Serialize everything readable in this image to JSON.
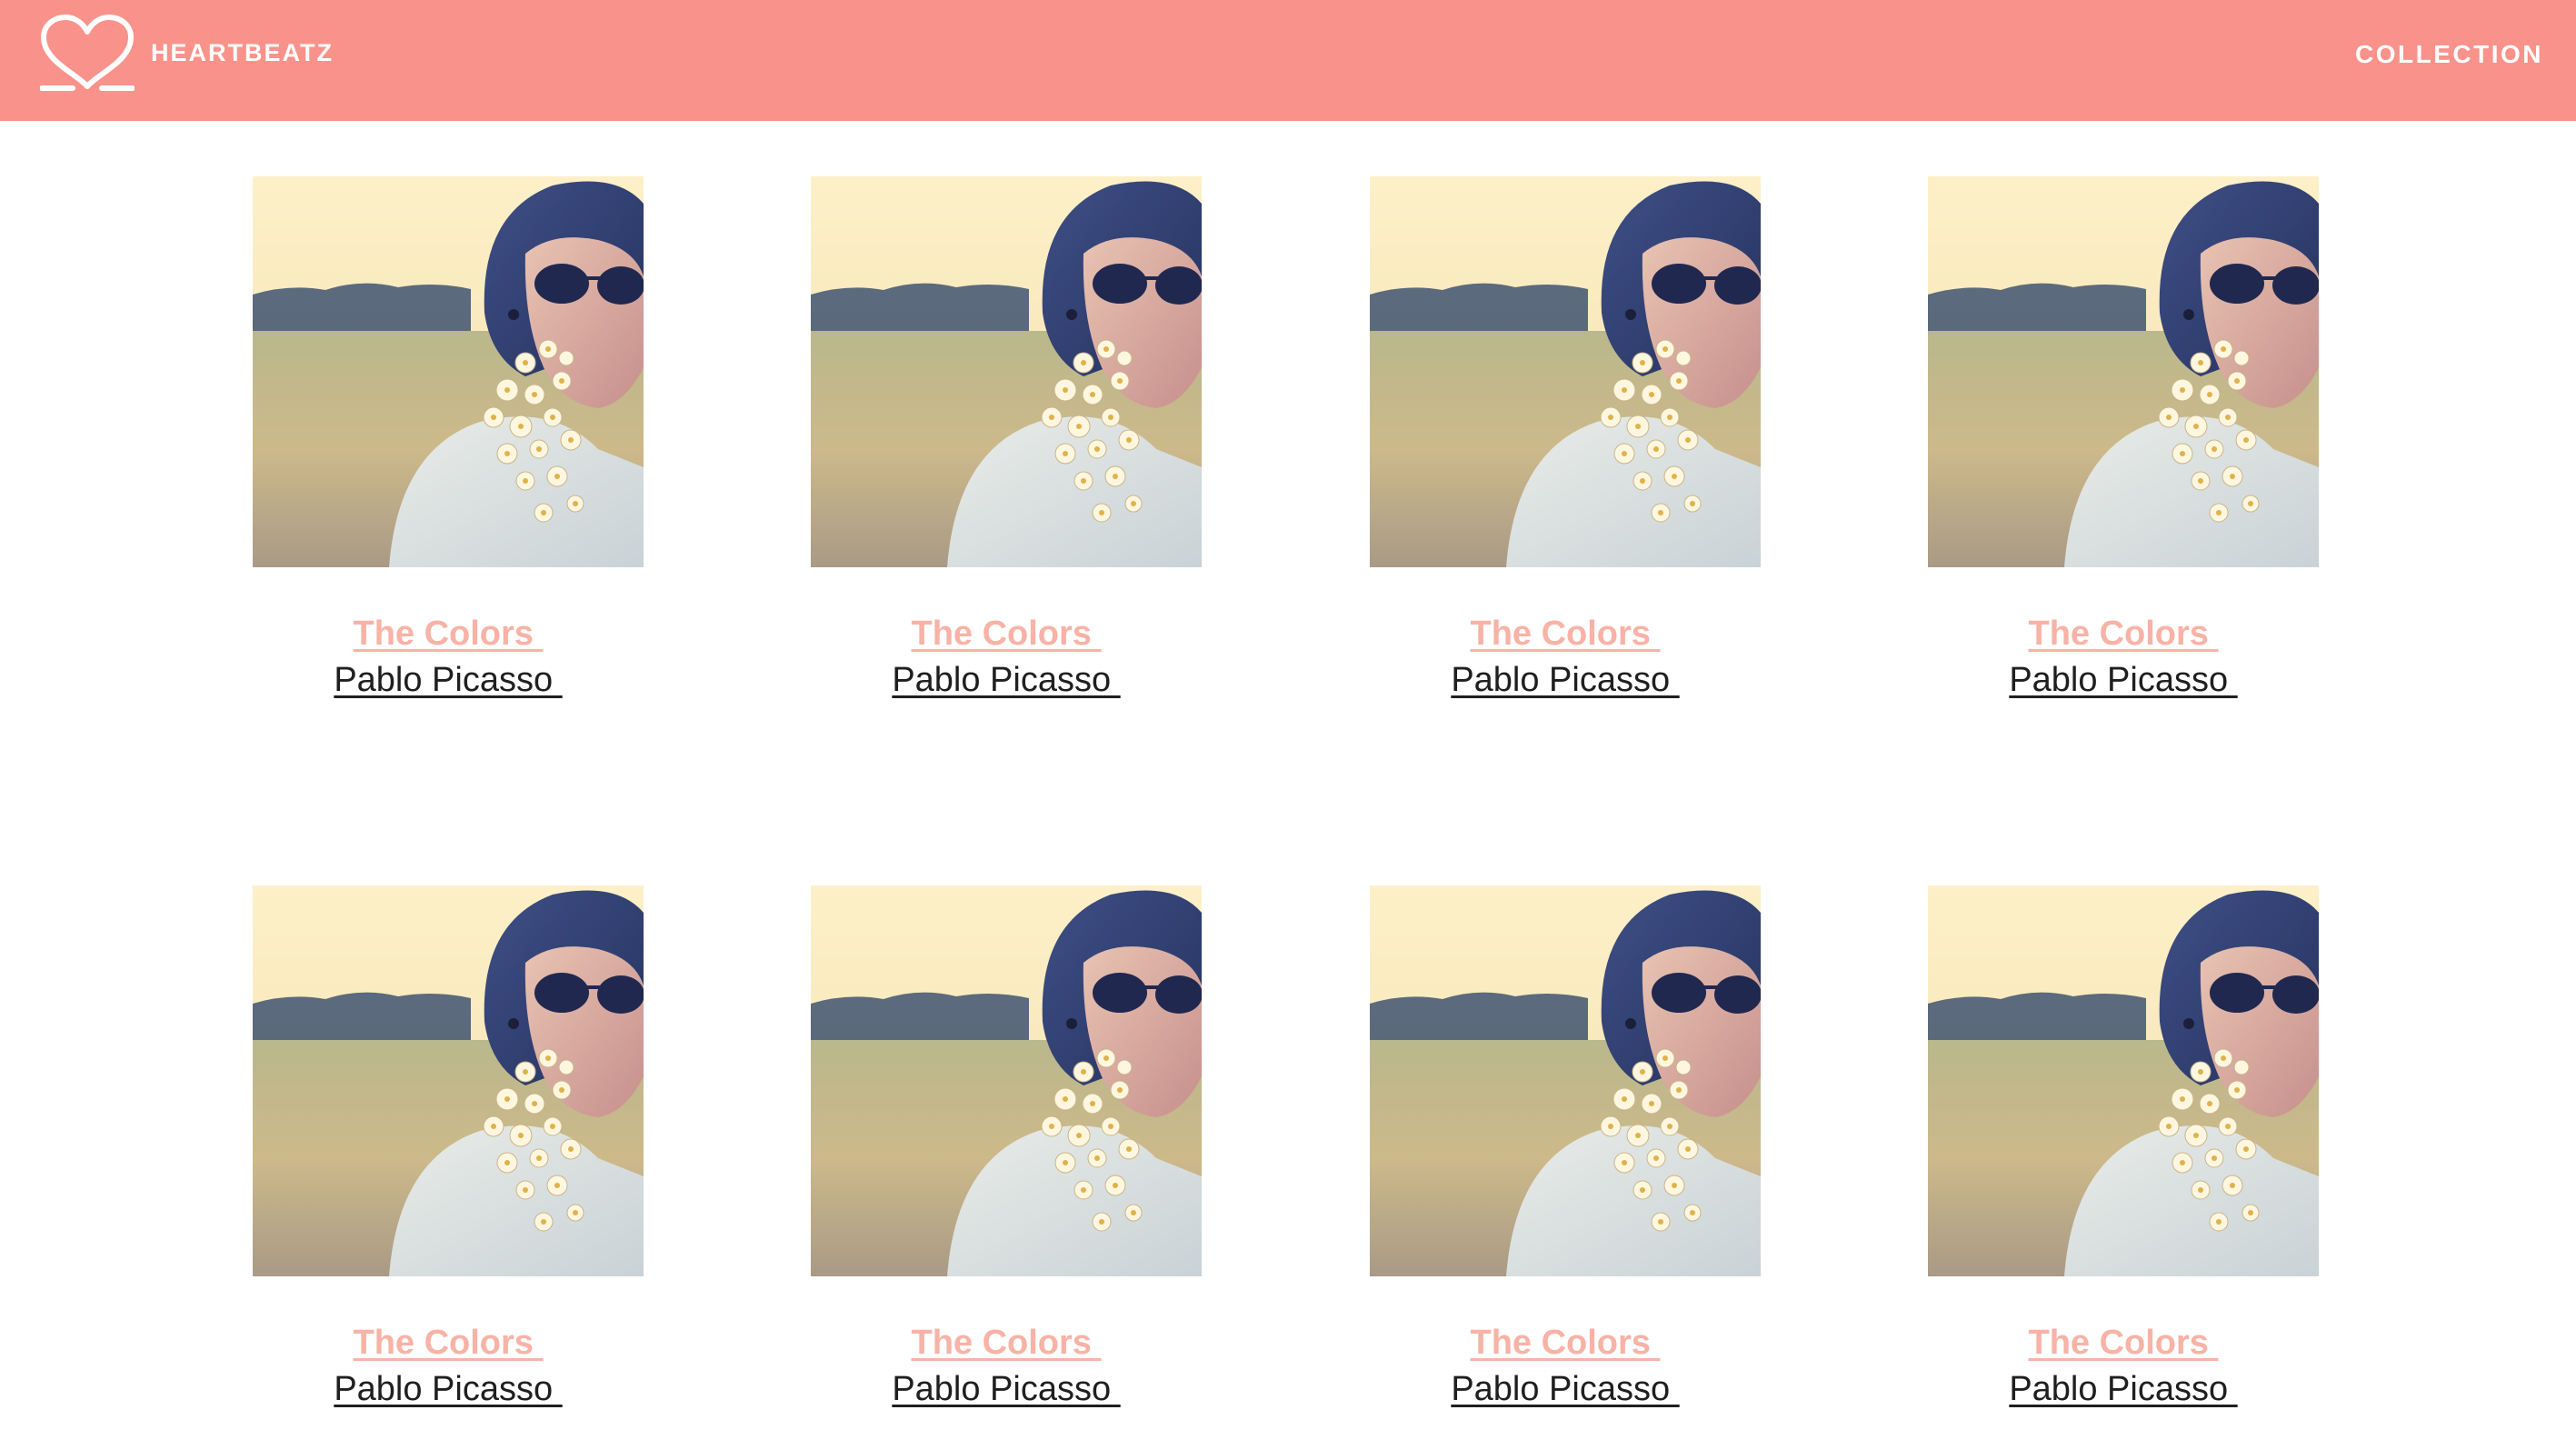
{
  "navbar": {
    "brand_name": "HEARTBEATZ",
    "logo_icon": "heart-outline-icon",
    "links": [
      {
        "label": "COLLECTION"
      }
    ]
  },
  "colors": {
    "navbar_bg": "#f9928a",
    "album_title": "#f8b2a6",
    "album_artist": "#1f1f1f"
  },
  "albums": [
    {
      "title": "The Colors ",
      "artist": "Pablo Picasso "
    },
    {
      "title": "The Colors ",
      "artist": "Pablo Picasso "
    },
    {
      "title": "The Colors ",
      "artist": "Pablo Picasso "
    },
    {
      "title": "The Colors ",
      "artist": "Pablo Picasso "
    },
    {
      "title": "The Colors ",
      "artist": "Pablo Picasso "
    },
    {
      "title": "The Colors ",
      "artist": "Pablo Picasso "
    },
    {
      "title": "The Colors ",
      "artist": "Pablo Picasso "
    },
    {
      "title": "The Colors ",
      "artist": "Pablo Picasso "
    }
  ]
}
